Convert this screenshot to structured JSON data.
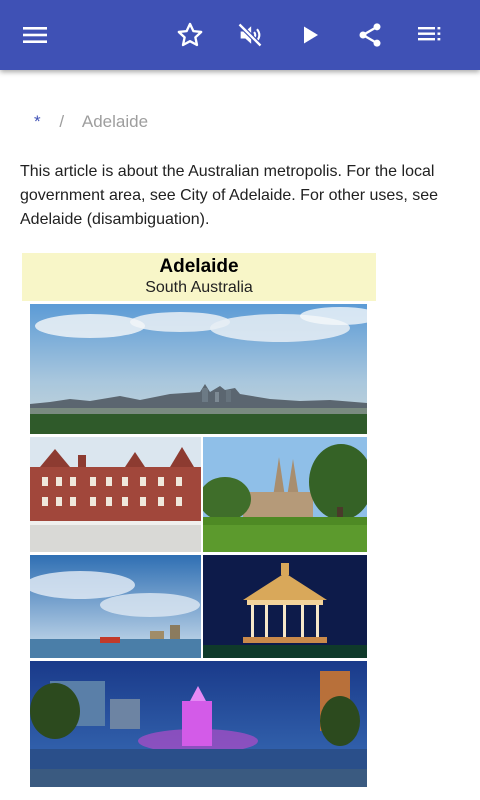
{
  "toolbar": {
    "icons": [
      "menu-icon",
      "star-icon",
      "volume-off-icon",
      "play-icon",
      "share-icon",
      "playlist-icon"
    ],
    "color": "#3f51b5"
  },
  "breadcrumb": {
    "root": "*",
    "separator": "/",
    "current": "Adelaide"
  },
  "article": {
    "intro": "This article is about the Australian metropolis. For the local government area, see City of Adelaide. For other uses, see Adelaide (disambiguation)."
  },
  "infobox": {
    "title": "Adelaide",
    "subtitle": "South Australia",
    "header_color": "#f8f6c8"
  }
}
